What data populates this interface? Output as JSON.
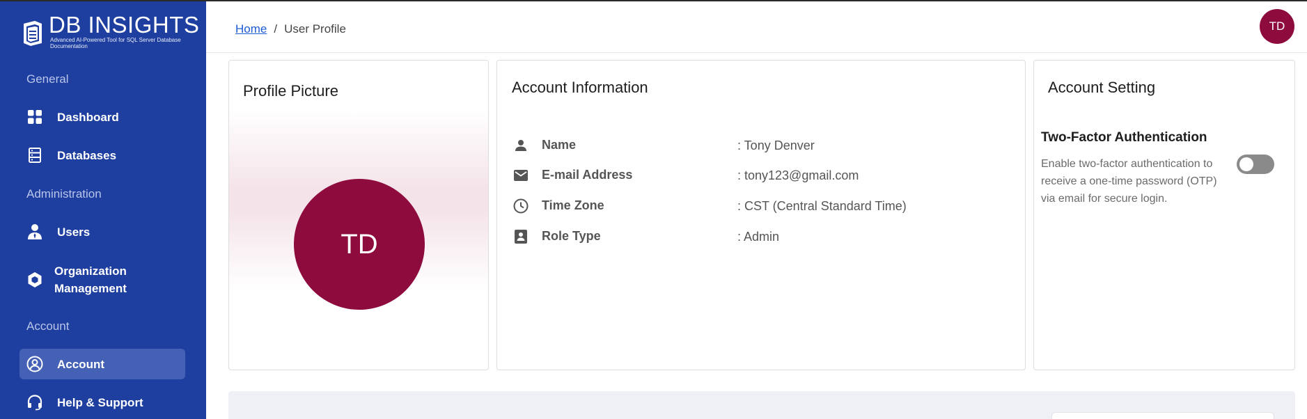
{
  "app": {
    "logo_title": "DB INSIGHTS",
    "logo_subtitle": "Advanced AI-Powered Tool for SQL Server Database Documentation"
  },
  "sidebar": {
    "sections": [
      {
        "label": "General"
      },
      {
        "label": "Administration"
      },
      {
        "label": "Account"
      }
    ],
    "items": [
      {
        "label": "Dashboard",
        "icon": "grid-icon"
      },
      {
        "label": "Databases",
        "icon": "database-icon"
      },
      {
        "label": "Users",
        "icon": "user-icon"
      },
      {
        "label": "Organization Management",
        "icon": "organization-icon"
      },
      {
        "label": "Account",
        "icon": "account-circle-icon",
        "active": true
      },
      {
        "label": "Help & Support",
        "icon": "headset-icon"
      }
    ]
  },
  "header": {
    "breadcrumb_home": "Home",
    "breadcrumb_separator": "/",
    "breadcrumb_current": "User Profile",
    "avatar_initials": "TD"
  },
  "profile_card": {
    "title": "Profile Picture",
    "initials": "TD"
  },
  "account_info": {
    "title": "Account Information",
    "rows": [
      {
        "label": "Name",
        "value": ": Tony Denver",
        "icon": "person-icon"
      },
      {
        "label": "E-mail Address",
        "value": ": tony123@gmail.com",
        "icon": "mail-icon"
      },
      {
        "label": "Time Zone",
        "value": ": CST (Central Standard Time)",
        "icon": "clock-icon"
      },
      {
        "label": "Role Type",
        "value": ": Admin",
        "icon": "badge-icon"
      }
    ]
  },
  "account_setting": {
    "title": "Account Setting",
    "tfa_title": "Two-Factor Authentication",
    "tfa_description": "Enable two-factor authentication to receive a one-time password (OTP) via email for secure login.",
    "tfa_enabled": false
  },
  "colors": {
    "sidebar_bg": "#1e3fa0",
    "active_item_bg": "#4461b5",
    "avatar_bg": "#8e0b3e",
    "link": "#1e5bd6"
  }
}
